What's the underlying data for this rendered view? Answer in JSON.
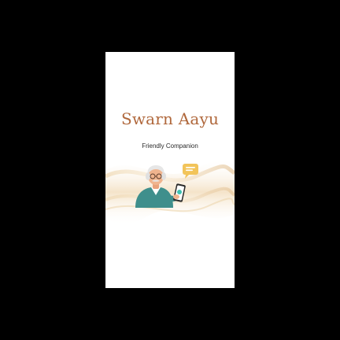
{
  "app": {
    "title": "Swarn Aayu",
    "subtitle": "Friendly Companion"
  },
  "colors": {
    "background_outer": "#000000",
    "screen_background": "#ffffff",
    "title_color": "#b0683c",
    "subtitle_color": "#2a2a2a",
    "wave_gold": "#d9b27a",
    "wave_light": "#f3e3c8",
    "speech_bubble": "#f2c45a",
    "phone_teal": "#3ec1b0",
    "shirt_teal": "#3f8f8c"
  },
  "icons": {
    "illustration": "elderly-man-with-phone-illustration",
    "speech_bubble": "chat-bubble-icon"
  }
}
